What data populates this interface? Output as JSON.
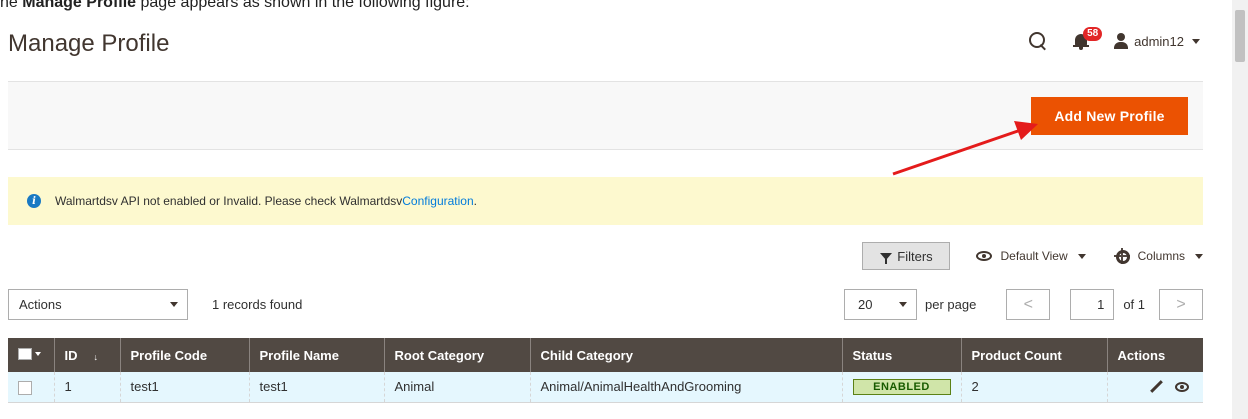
{
  "intro": {
    "prefix": "he ",
    "bold": "Manage Profile",
    "suffix": " page appears as shown in the following figure:"
  },
  "page": {
    "title": "Manage Profile"
  },
  "header": {
    "notification_count": "58",
    "username": "admin12"
  },
  "action_bar": {
    "add_button_label": "Add New Profile",
    "accent_color": "#eb5202"
  },
  "notice": {
    "text": "Walmartdsv API not enabled or Invalid. Please check Walmartdsv ",
    "link_text": "Configuration",
    "trailing": ".",
    "background": "#fdf9cf"
  },
  "toolbar": {
    "filters_label": "Filters",
    "view_label": "Default View",
    "columns_label": "Columns"
  },
  "mass_actions": {
    "selected": "Actions"
  },
  "records_found": "1 records found",
  "pager": {
    "per_page_value": "20",
    "per_page_label": "per page",
    "current_page": "1",
    "of_label": "of 1",
    "prev": "<",
    "next": ">"
  },
  "grid": {
    "headers": [
      "ID",
      "Profile Code",
      "Profile Name",
      "Root Category",
      "Child Category",
      "Status",
      "Product Count",
      "Actions"
    ],
    "rows": [
      {
        "id": "1",
        "profile_code": "test1",
        "profile_name": "test1",
        "root_category": "Animal",
        "child_category": "Animal/AnimalHealthAndGrooming",
        "status": "ENABLED",
        "product_count": "2"
      }
    ]
  }
}
